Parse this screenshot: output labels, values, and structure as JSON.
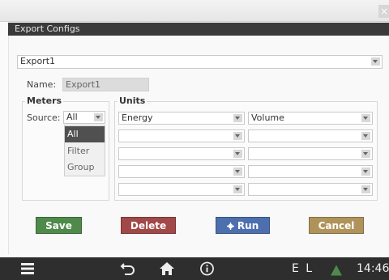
{
  "window": {
    "close_glyph": "×"
  },
  "dialog": {
    "title": "Export Configs",
    "config_select": "Export1",
    "name_label": "Name:",
    "name_value": "Export1",
    "meters": {
      "legend": "Meters",
      "source_label": "Source:",
      "source_value": "All",
      "options": [
        "All",
        "Filter",
        "Group"
      ],
      "selected_index": 0
    },
    "units": {
      "legend": "Units",
      "rows": [
        [
          "Energy",
          "Volume"
        ],
        [
          "",
          ""
        ],
        [
          "",
          ""
        ],
        [
          "",
          ""
        ],
        [
          "",
          ""
        ]
      ]
    },
    "buttons": {
      "save": "Save",
      "delete": "Delete",
      "run": "Run",
      "cancel": "Cancel"
    }
  },
  "navbar": {
    "icons": [
      "menu-icon",
      "back-icon",
      "home-icon",
      "info-icon",
      "warning-icon"
    ],
    "status_letters": "E L",
    "time": "14:46",
    "warning_color": "#4f8a4a"
  },
  "colors": {
    "save": "#4f8a4a",
    "delete": "#a14848",
    "run": "#4d6fae",
    "cancel": "#b0935a",
    "titlebar": "#3a3a3a"
  }
}
